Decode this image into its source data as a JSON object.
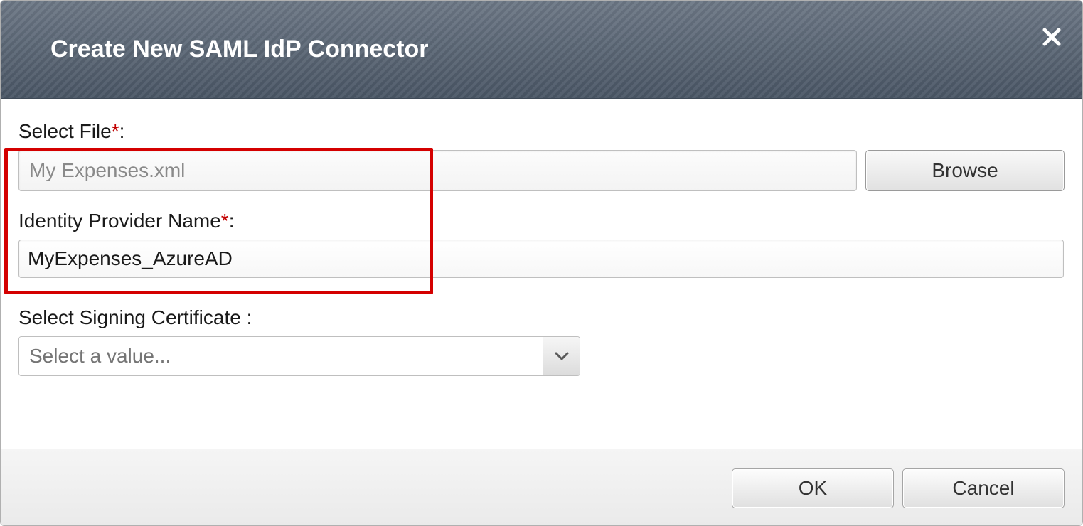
{
  "dialog": {
    "title": "Create New SAML IdP Connector"
  },
  "form": {
    "file": {
      "label": "Select File",
      "value": "My Expenses.xml",
      "browse": "Browse"
    },
    "idp": {
      "label": "Identity Provider Name",
      "value": "MyExpenses_AzureAD"
    },
    "cert": {
      "label": "Select Signing Certificate  :",
      "placeholder": "Select a value..."
    }
  },
  "actions": {
    "ok": "OK",
    "cancel": "Cancel"
  },
  "symbols": {
    "required": "*",
    "colon": ":"
  }
}
